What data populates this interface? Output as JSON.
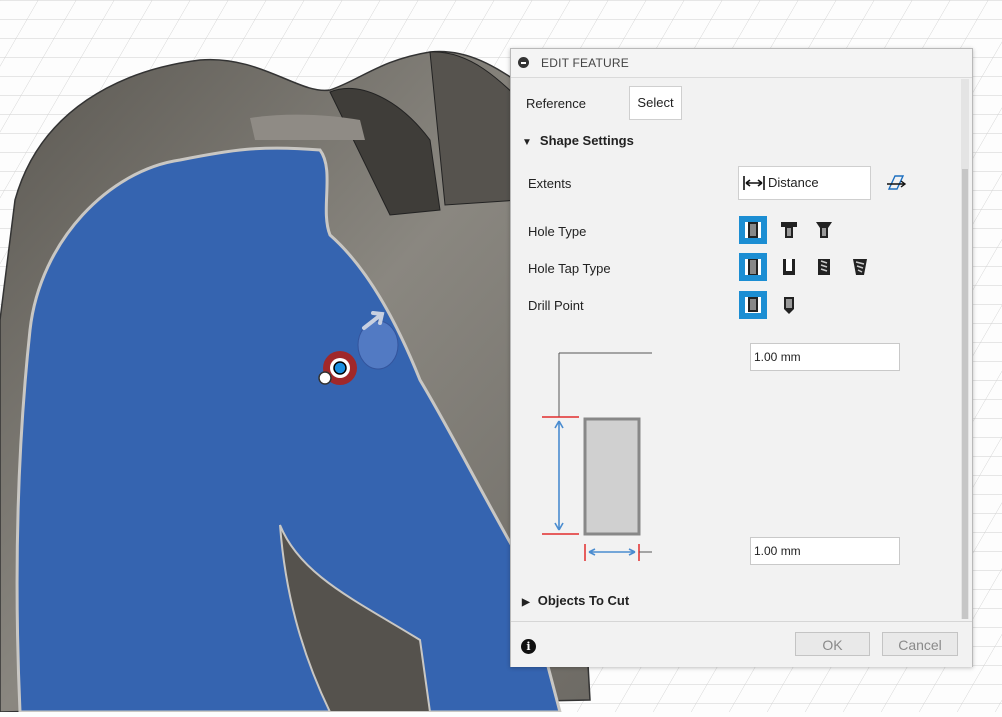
{
  "dialog": {
    "title": "EDIT FEATURE",
    "reference": {
      "label": "Reference",
      "button": "Select"
    },
    "shape_settings": {
      "header": "Shape Settings",
      "extents": {
        "label": "Extents",
        "value": "Distance"
      },
      "hole_type": {
        "label": "Hole Type",
        "options": [
          "simple",
          "counterbore",
          "countersink"
        ],
        "selected": 0
      },
      "hole_tap_type": {
        "label": "Hole Tap Type",
        "options": [
          "simple",
          "clearance",
          "tapped",
          "taper-tapped"
        ],
        "selected": 0
      },
      "drill_point": {
        "label": "Drill Point",
        "options": [
          "flat",
          "angled"
        ],
        "selected": 0
      },
      "depth_value": "1.00 mm",
      "diameter_value": "1.00 mm"
    },
    "objects_to_cut": {
      "header": "Objects To Cut"
    },
    "footer": {
      "ok": "OK",
      "cancel": "Cancel"
    }
  },
  "colors": {
    "accent": "#1c8ed3",
    "face_blue": "#3564b0",
    "body_gray": "#7a7670",
    "dim_red": "#e22d2d",
    "dim_blue": "#4a8cd0"
  }
}
